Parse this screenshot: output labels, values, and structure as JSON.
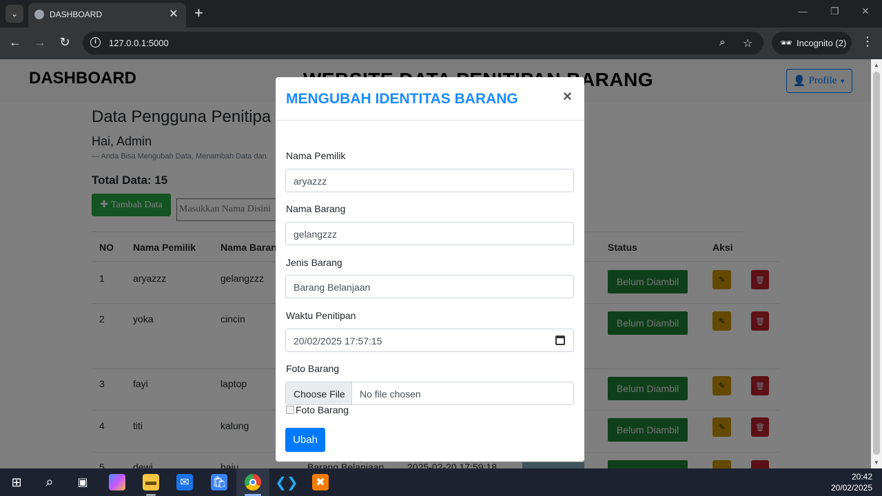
{
  "browser": {
    "tab_title": "DASHBOARD",
    "url": "127.0.0.1:5000",
    "incognito_label": "Incognito (2)"
  },
  "page": {
    "brand": "DASHBOARD",
    "site_title": "WEBSITE DATA PENITIPAN BARANG",
    "profile_label": "Profile",
    "heading": "Data Pengguna Penitipa",
    "greeting": "Hai, Admin",
    "note": "— Anda Bisa Mengubah Data, Menambah Data dan",
    "total": "Total Data: 15",
    "add_button": "Tambah Data",
    "search_placeholder": "Masukkan Nama Disini"
  },
  "table": {
    "headers": {
      "no": "NO",
      "owner": "Nama Pemilik",
      "item": "Nama Barang",
      "status": "Status",
      "action": "Aksi"
    },
    "rows": [
      {
        "no": "1",
        "owner": "aryazzz",
        "item": "gelangzzz",
        "status": "Belum Diambil"
      },
      {
        "no": "2",
        "owner": "yoka",
        "item": "cincin",
        "status": "Belum Diambil"
      },
      {
        "no": "3",
        "owner": "fayi",
        "item": "laptop",
        "status": "Belum Diambil"
      },
      {
        "no": "4",
        "owner": "titi",
        "item": "kalung",
        "status": "Belum Diambil"
      },
      {
        "no": "5",
        "owner": "dewi",
        "item": "baju",
        "type": "Barang Belanjaan",
        "time": "2025-02-20 17:59:18"
      }
    ]
  },
  "modal": {
    "title": "MENGUBAH IDENTITAS BARANG",
    "close": "×",
    "fields": {
      "owner_label": "Nama Pemilik",
      "owner_value": "aryazzz",
      "item_label": "Nama Barang",
      "item_value": "gelangzzz",
      "type_label": "Jenis Barang",
      "type_value": "Barang Belanjaan",
      "time_label": "Waktu Penitipan",
      "time_value": "20/02/2025 17:57:15",
      "photo_label": "Foto Barang",
      "file_button": "Choose File",
      "file_status": "No file chosen",
      "photo_alt": "Foto Barang"
    },
    "submit": "Ubah"
  },
  "taskbar": {
    "time": "20:42",
    "date": "20/02/2025"
  },
  "colors": {
    "accent_blue": "#007bff",
    "success_green": "#28a745",
    "warning_yellow": "#ffc107",
    "danger_red": "#dc3545"
  }
}
